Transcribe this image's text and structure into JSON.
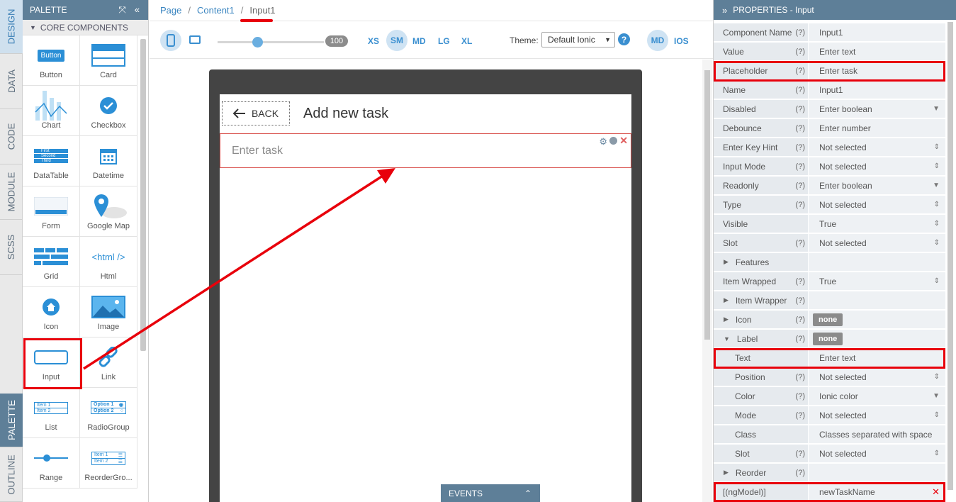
{
  "vtabs": {
    "design": "DESIGN",
    "data": "DATA",
    "code": "CODE",
    "module": "MODULE",
    "scss": "SCSS",
    "palette": "PALETTE",
    "outline": "OUTLINE"
  },
  "palette": {
    "title": "PALETTE",
    "section": "CORE COMPONENTS",
    "items": [
      "Button",
      "Card",
      "Chart",
      "Checkbox",
      "DataTable",
      "Datetime",
      "Form",
      "Google Map",
      "Grid",
      "Html",
      "Icon",
      "Image",
      "Input",
      "Link",
      "List",
      "RadioGroup",
      "Range",
      "ReorderGro..."
    ],
    "button_icon_text": "Button",
    "html_icon_text": "<html />",
    "list_icon": [
      "Item 1",
      "Item 2"
    ],
    "radio_icon": [
      "Option 1",
      "Option 2"
    ],
    "reorder_icon": [
      "Item 1",
      "Item 2"
    ],
    "datatable_icon": [
      "First",
      "Second",
      "Third"
    ]
  },
  "breadcrumb": {
    "page": "Page",
    "content": "Content1",
    "input": "Input1"
  },
  "toolbar": {
    "zoom": "100",
    "breakpoints": [
      "XS",
      "SM",
      "MD",
      "LG",
      "XL"
    ],
    "theme_label": "Theme:",
    "theme_value": "Default Ionic",
    "mode_md": "MD",
    "mode_ios": "IOS"
  },
  "device": {
    "back": "BACK",
    "title": "Add new task",
    "placeholder": "Enter task"
  },
  "events": "EVENTS",
  "properties": {
    "title": "PROPERTIES - Input",
    "rows": [
      {
        "name": "Component Name",
        "q": "(?)",
        "value": "Input1"
      },
      {
        "name": "Value",
        "q": "(?)",
        "value": "Enter text"
      },
      {
        "name": "Placeholder",
        "q": "(?)",
        "value": "Enter task"
      },
      {
        "name": "Name",
        "q": "(?)",
        "value": "Input1"
      },
      {
        "name": "Disabled",
        "q": "(?)",
        "value": "Enter boolean",
        "arrow": "▼"
      },
      {
        "name": "Debounce",
        "q": "(?)",
        "value": "Enter number"
      },
      {
        "name": "Enter Key Hint",
        "q": "(?)",
        "value": "Not selected",
        "arrow": "⇕"
      },
      {
        "name": "Input Mode",
        "q": "(?)",
        "value": "Not selected",
        "arrow": "⇕"
      },
      {
        "name": "Readonly",
        "q": "(?)",
        "value": "Enter boolean",
        "arrow": "▼"
      },
      {
        "name": "Type",
        "q": "(?)",
        "value": "Not selected",
        "arrow": "⇕"
      },
      {
        "name": "Visible",
        "q": "",
        "value": "True",
        "arrow": "⇕"
      },
      {
        "name": "Slot",
        "q": "(?)",
        "value": "Not selected",
        "arrow": "⇕"
      },
      {
        "name": "Features",
        "q": "",
        "value": "",
        "tri": "▶"
      },
      {
        "name": "Item Wrapped",
        "q": "(?)",
        "value": "True",
        "arrow": "⇕"
      },
      {
        "name": "Item Wrapper",
        "q": "(?)",
        "value": "",
        "tri": "▶"
      },
      {
        "name": "Icon",
        "q": "(?)",
        "value": "none",
        "badge": true,
        "tri": "▶"
      },
      {
        "name": "Label",
        "q": "(?)",
        "value": "none",
        "badge": true,
        "tri": "▼"
      },
      {
        "name": "Text",
        "q": "",
        "value": "Enter text",
        "indent": true
      },
      {
        "name": "Position",
        "q": "(?)",
        "value": "Not selected",
        "arrow": "⇕",
        "indent": true
      },
      {
        "name": "Color",
        "q": "(?)",
        "value": "Ionic color",
        "arrow": "▼",
        "indent": true
      },
      {
        "name": "Mode",
        "q": "(?)",
        "value": "Not selected",
        "arrow": "⇕",
        "indent": true
      },
      {
        "name": "Class",
        "q": "",
        "value": "Classes separated with space",
        "indent": true
      },
      {
        "name": "Slot",
        "q": "(?)",
        "value": "Not selected",
        "arrow": "⇕",
        "indent": true
      },
      {
        "name": "Reorder",
        "q": "(?)",
        "value": "",
        "tri": "▶"
      },
      {
        "name": "[(ngModel)]",
        "q": "",
        "value": "newTaskName",
        "close": "✕"
      }
    ]
  },
  "colors": {
    "accent": "#5e7f98",
    "link": "#3a85c0",
    "highlight": "#e8000b"
  }
}
